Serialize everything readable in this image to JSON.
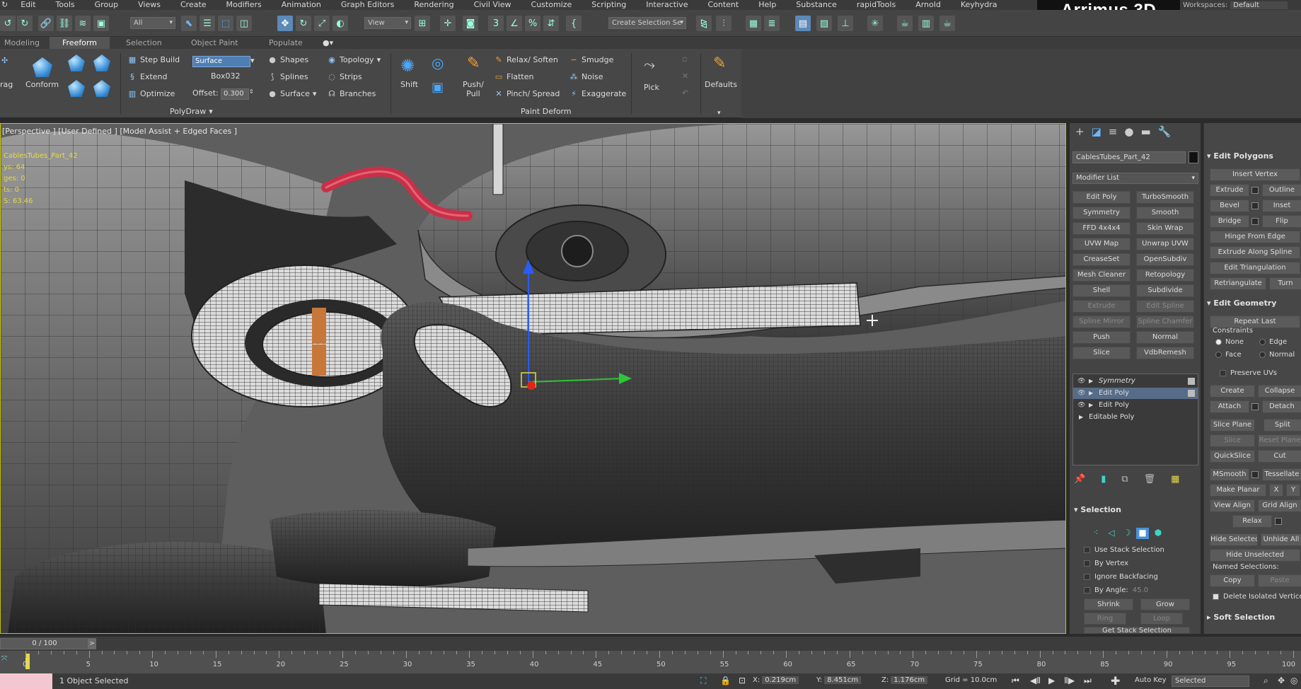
{
  "menubar": {
    "items": [
      "Edit",
      "Tools",
      "Group",
      "Views",
      "Create",
      "Modifiers",
      "Animation",
      "Graph Editors",
      "Rendering",
      "Civil View",
      "Customize",
      "Scripting",
      "Interactive",
      "Content",
      "Help",
      "Substance",
      "rapidTools",
      "Arnold",
      "Keyhydra"
    ],
    "brand": "Arrimus 3D",
    "workspaces_label": "Workspaces:",
    "workspaces_value": "Default"
  },
  "toolbar": {
    "filter_value": "All",
    "refcoord_value": "View",
    "selection_set_placeholder": "Create Selection Se"
  },
  "ribbon_tabs": [
    "Modeling",
    "Freeform",
    "Selection",
    "Object Paint",
    "Populate"
  ],
  "ribbon": {
    "drag_label": "rag",
    "conform_label": "Conform",
    "step_build": "Step Build",
    "extend": "Extend",
    "optimize": "Optimize",
    "surface_mode": "Surface",
    "target_object": "Box032",
    "offset_label": "Offset:",
    "offset_value": "0.300",
    "shapes": "Shapes",
    "splines": "Splines",
    "surface_dd": "Surface",
    "topology": "Topology",
    "strips": "Strips",
    "branches": "Branches",
    "polydraw_group": "PolyDraw",
    "shift_label": "Shift",
    "push_pull_label": "Push/\nPull",
    "relax_soften": "Relax/ Soften",
    "flatten": "Flatten",
    "pinch_spread": "Pinch/ Spread",
    "smudge": "Smudge",
    "noise": "Noise",
    "exaggerate": "Exaggerate",
    "paint_deform_group": "Paint Deform",
    "pick_label": "Pick",
    "defaults_label": "Defaults"
  },
  "viewport": {
    "label": "[Perspective ] [User Defined ] [Model Assist + Edged Faces ]",
    "stats": {
      "object": "CablesTubes_Part_42",
      "polys_label": "ys:",
      "polys": "64",
      "edges_label": "ges:",
      "edges": "0",
      "verts_label": "ts:",
      "verts": "0",
      "fps_label": "S:",
      "fps": "63.46"
    }
  },
  "command_panel": {
    "object_name": "CablesTubes_Part_42",
    "modifier_list": "Modifier List",
    "modifier_buttons": [
      [
        "Edit Poly",
        "TurboSmooth"
      ],
      [
        "Symmetry",
        "Smooth"
      ],
      [
        "FFD 4x4x4",
        "Skin Wrap"
      ],
      [
        "UVW Map",
        "Unwrap UVW"
      ],
      [
        "CreaseSet",
        "OpenSubdiv"
      ],
      [
        "Mesh Cleaner",
        "Retopology"
      ],
      [
        "Shell",
        "Subdivide"
      ],
      [
        "Extrude",
        "Edit Spline"
      ],
      [
        "Spline Mirror",
        "Spline Chamfer"
      ],
      [
        "Push",
        "Normal"
      ],
      [
        "Slice",
        "VdbRemesh"
      ]
    ],
    "stack": [
      "Symmetry",
      "Edit Poly",
      "Edit Poly",
      "Editable Poly"
    ],
    "selection": {
      "header": "Selection",
      "use_stack": "Use Stack Selection",
      "by_vertex": "By Vertex",
      "ignore_backfacing": "Ignore Backfacing",
      "by_angle": "By Angle:",
      "by_angle_value": "45.0",
      "shrink": "Shrink",
      "grow": "Grow",
      "ring": "Ring",
      "loop": "Loop",
      "get_stack": "Get Stack Selection"
    }
  },
  "edit_panel": {
    "edit_polygons_header": "Edit Polygons",
    "insert_vertex": "Insert Vertex",
    "extrude": "Extrude",
    "outline": "Outline",
    "bevel": "Bevel",
    "inset": "Inset",
    "bridge": "Bridge",
    "flip": "Flip",
    "hinge": "Hinge From Edge",
    "extrude_spline": "Extrude Along Spline",
    "edit_triangulation": "Edit Triangulation",
    "retriangulate": "Retriangulate",
    "turn": "Turn",
    "edit_geometry_header": "Edit Geometry",
    "repeat_last": "Repeat Last",
    "constraints": "Constraints",
    "none": "None",
    "edge": "Edge",
    "face": "Face",
    "normal": "Normal",
    "preserve_uvs": "Preserve UVs",
    "create": "Create",
    "collapse": "Collapse",
    "attach": "Attach",
    "detach": "Detach",
    "slice_plane": "Slice Plane",
    "split": "Split",
    "slice": "Slice",
    "reset_plane": "Reset Plane",
    "quickslice": "QuickSlice",
    "cut": "Cut",
    "msmooth": "MSmooth",
    "tessellate": "Tessellate",
    "make_planar": "Make Planar",
    "x": "X",
    "y": "Y",
    "view_align": "View Align",
    "grid_align": "Grid Align",
    "relax": "Relax",
    "hide_selected": "Hide Selected",
    "unhide_all": "Unhide All",
    "hide_unselected": "Hide Unselected",
    "named_selections": "Named Selections:",
    "copy": "Copy",
    "paste": "Paste",
    "delete_isolated": "Delete Isolated Vertices",
    "soft_selection_header": "Soft Selection"
  },
  "timeline": {
    "frame": "0 / 100",
    "ticks": [
      0,
      5,
      10,
      15,
      20,
      25,
      30,
      35,
      40,
      45,
      50,
      55,
      60,
      65,
      70,
      75,
      80,
      85,
      90,
      95,
      100
    ]
  },
  "statusbar": {
    "status": "1 Object Selected",
    "x_label": "X:",
    "x_value": "0.219cm",
    "y_label": "Y:",
    "y_value": "8.451cm",
    "z_label": "Z:",
    "z_value": "1.176cm",
    "grid": "Grid = 10.0cm",
    "autokey": "Auto Key",
    "selected": "Selected"
  },
  "colors": {
    "viewport_border": "#c4c400",
    "selection_highlight": "#566c88",
    "brand_bg": "#111111"
  }
}
